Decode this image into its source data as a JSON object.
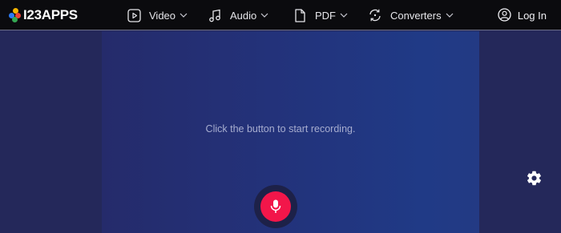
{
  "brand": {
    "name": "I23APPS",
    "dot_colors": [
      "#f5b400",
      "#2d7cf6",
      "#ea4335",
      "#34a853"
    ]
  },
  "nav": {
    "items": [
      {
        "label": "Video",
        "icon": "video-play-icon"
      },
      {
        "label": "Audio",
        "icon": "music-note-icon"
      },
      {
        "label": "PDF",
        "icon": "document-icon"
      },
      {
        "label": "Converters",
        "icon": "refresh-cycle-icon"
      }
    ],
    "login_label": "Log In",
    "login_icon": "user-circle-icon"
  },
  "main": {
    "hint": "Click the button to start recording.",
    "record_icon": "microphone-icon",
    "settings_icon": "gear-icon"
  },
  "colors": {
    "topbar": "#0b0b0e",
    "record_button": "#f2164a",
    "background": "#25285a",
    "panel": "#23327a"
  }
}
